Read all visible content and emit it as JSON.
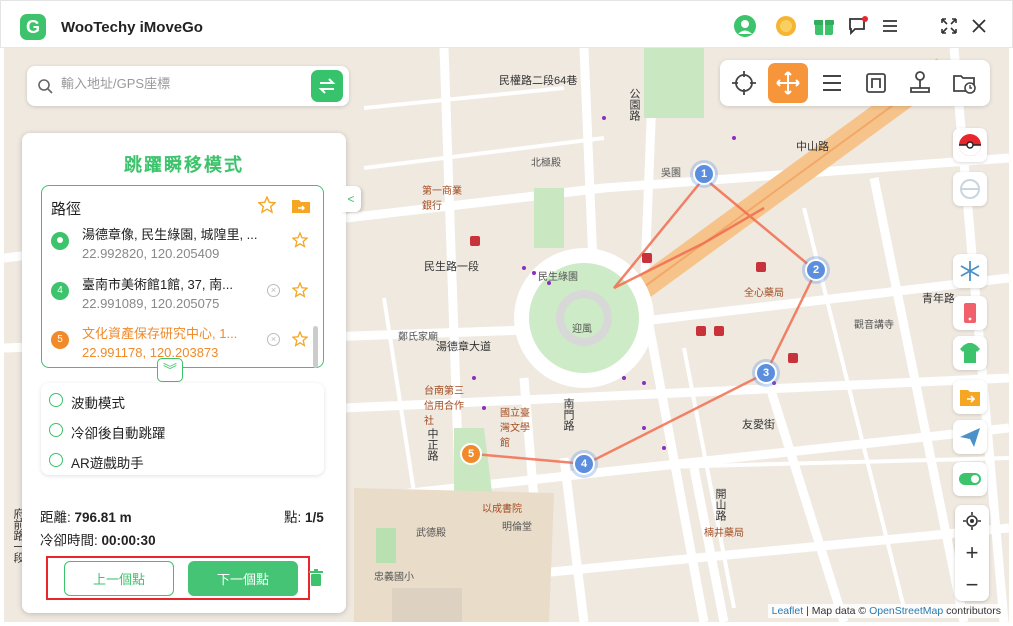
{
  "app": {
    "title": "WooTechy iMoveGo"
  },
  "search": {
    "placeholder": "輸入地址/GPS座標"
  },
  "panel": {
    "title": "跳躍瞬移模式",
    "route_label": "路徑",
    "route_items": [
      {
        "title": "湯德章像, 民生綠園, 城隍里, ...",
        "coord": "22.992820, 120.205409",
        "marker": "",
        "color": "#3cc36b"
      },
      {
        "title": "臺南市美術館1館, 37, 南...",
        "coord": "22.991089, 120.205075",
        "marker": "4",
        "color": "#3cc36b"
      },
      {
        "title": "文化資產保存研究中心, 1...",
        "coord": "22.991178, 120.203873",
        "marker": "5",
        "color": "#f08a2a"
      }
    ],
    "options": [
      "波動模式",
      "冷卻後自動跳躍",
      "AR遊戲助手"
    ],
    "distance_label": "距離:",
    "distance_value": "796.81 m",
    "points_label": "點:",
    "points_value": "1/5",
    "cooldown_label": "冷卻時間:",
    "cooldown_value": "00:00:30",
    "prev_button": "上一個點",
    "next_button": "下一個點"
  },
  "map": {
    "labels": [
      {
        "text": "民權路二段64巷",
        "cls": "road"
      },
      {
        "text": "公園路",
        "cls": "road"
      },
      {
        "text": "中山路",
        "cls": "road"
      },
      {
        "text": "民生路一段",
        "cls": "road"
      },
      {
        "text": "湯德章大道",
        "cls": "road"
      },
      {
        "text": "友愛街",
        "cls": "road"
      },
      {
        "text": "南門路",
        "cls": "road"
      },
      {
        "text": "中正路",
        "cls": "road"
      },
      {
        "text": "開山路",
        "cls": "road"
      },
      {
        "text": "青年路",
        "cls": "road"
      },
      {
        "text": "府前路一段",
        "cls": "road"
      },
      {
        "text": "國立臺灣文學館",
        "cls": "poi"
      },
      {
        "text": "全心藥局",
        "cls": "poi"
      },
      {
        "text": "觀音講寺",
        "cls": "poi"
      },
      {
        "text": "以成書院",
        "cls": "poi"
      },
      {
        "text": "忠義國小",
        "cls": ""
      },
      {
        "text": "武德殿",
        "cls": ""
      },
      {
        "text": "明倫堂",
        "cls": ""
      },
      {
        "text": "迎風",
        "cls": ""
      },
      {
        "text": "吳園",
        "cls": ""
      },
      {
        "text": "北極殿",
        "cls": ""
      },
      {
        "text": "鄭氏家廟",
        "cls": ""
      },
      {
        "text": "台南第三信用合作社",
        "cls": "poi"
      },
      {
        "text": "民生綠園",
        "cls": ""
      },
      {
        "text": "第一商業銀行",
        "cls": "poi"
      },
      {
        "text": "楠井藥局",
        "cls": "poi"
      }
    ],
    "markers": [
      "1",
      "2",
      "3",
      "4",
      "5"
    ],
    "attribution_leaflet": "Leaflet",
    "attribution_text": "| Map data ©",
    "attribution_osm": "OpenStreetMap",
    "attribution_tail": "contributors"
  }
}
